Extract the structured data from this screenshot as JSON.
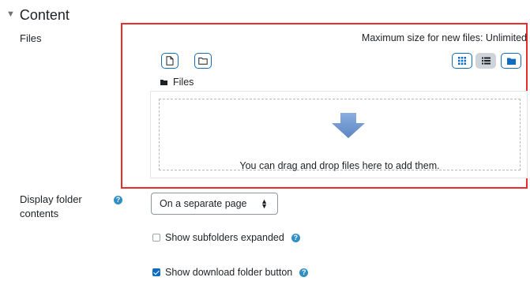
{
  "section": {
    "title": "Content",
    "caret_icon": "chevron-down-icon"
  },
  "files_field": {
    "label": "Files",
    "max_size_text": "Maximum size for new files: Unlimited",
    "path_label": "Files",
    "drop_text": "You can drag and drop files here to add them.",
    "accent_color": "#0f6cbf",
    "highlight_color": "#e62c2c"
  },
  "display_field": {
    "label": "Display folder contents",
    "selected_option": "On a separate page"
  },
  "options": {
    "show_subfolders_label": "Show subfolders expanded",
    "show_subfolders_checked": false,
    "show_download_label": "Show download folder button",
    "show_download_checked": true
  },
  "icons": {
    "help": "?"
  }
}
